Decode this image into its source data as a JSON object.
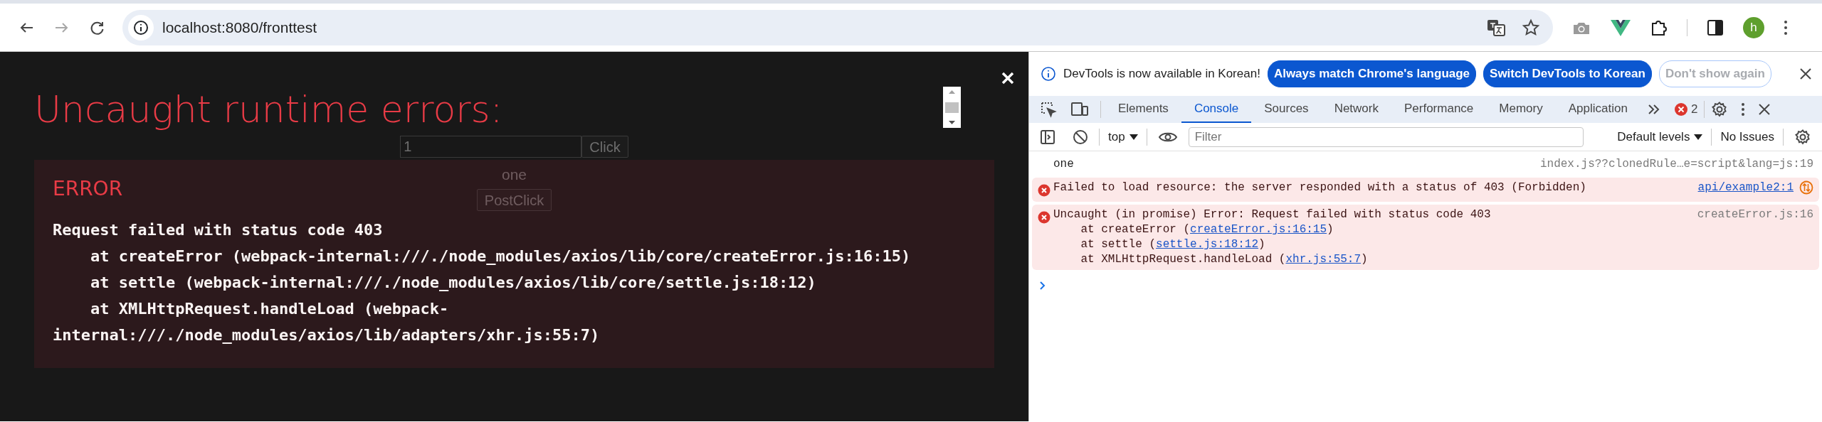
{
  "browser": {
    "nav_buttons": [
      {
        "kind": "back",
        "disabled": false
      },
      {
        "kind": "forward",
        "disabled": true
      },
      {
        "kind": "reload",
        "disabled": false
      }
    ],
    "url": "localhost:8080/fronttest",
    "avatar": "h"
  },
  "page": {
    "input_value": "1",
    "click_button": "Click",
    "text": "one",
    "post_button": "PostClick"
  },
  "overlay": {
    "title": "Uncaught runtime errors:",
    "errors": [
      {
        "heading": "ERROR",
        "message": "Request failed with status code 403\n    at createError (webpack-internal:///./node_modules/axios/lib/core/createError.js:16:15)\n    at settle (webpack-internal:///./node_modules/axios/lib/core/settle.js:18:12)\n    at XMLHttpRequest.handleLoad (webpack-internal:///./node_modules/axios/lib/adapters/xhr.js:55:7)"
      }
    ]
  },
  "devtools": {
    "infobar": {
      "text": "DevTools is now available in Korean!",
      "buttons": [
        {
          "label": "Always match Chrome's language",
          "kind": "primary"
        },
        {
          "label": "Switch DevTools to Korean",
          "kind": "primary"
        },
        {
          "label": "Don't show again",
          "kind": "secondary"
        }
      ]
    },
    "tabs": [
      {
        "label": "Elements",
        "selected": false
      },
      {
        "label": "Console",
        "selected": true
      },
      {
        "label": "Sources",
        "selected": false
      },
      {
        "label": "Network",
        "selected": false
      },
      {
        "label": "Performance",
        "selected": false
      },
      {
        "label": "Memory",
        "selected": false
      },
      {
        "label": "Application",
        "selected": false
      }
    ],
    "error_count": "2",
    "console_toolbar": {
      "context": "top",
      "filter_placeholder": "Filter",
      "levels": "Default levels",
      "issues": "No Issues"
    },
    "messages": [
      {
        "kind": "log",
        "text": "one",
        "source": "index.js??clonedRule…e=script&lang=js:19",
        "source_link": false
      },
      {
        "kind": "error",
        "text": "Failed to load resource: the server responded with a status of 403 (Forbidden)",
        "source": "api/example2:1",
        "source_link": true,
        "network_request": true
      },
      {
        "kind": "error",
        "text": "Uncaught (in promise) Error: Request failed with status code 403",
        "source": "createError.js:16",
        "source_link": false,
        "stack": [
          {
            "prefix": "at createError (",
            "link": "createError.js:16:15",
            "suffix": ")"
          },
          {
            "prefix": "at settle (",
            "link": "settle.js:18:12",
            "suffix": ")"
          },
          {
            "prefix": "at XMLHttpRequest.handleLoad (",
            "link": "xhr.js:55:7",
            "suffix": ")"
          }
        ]
      }
    ]
  }
}
